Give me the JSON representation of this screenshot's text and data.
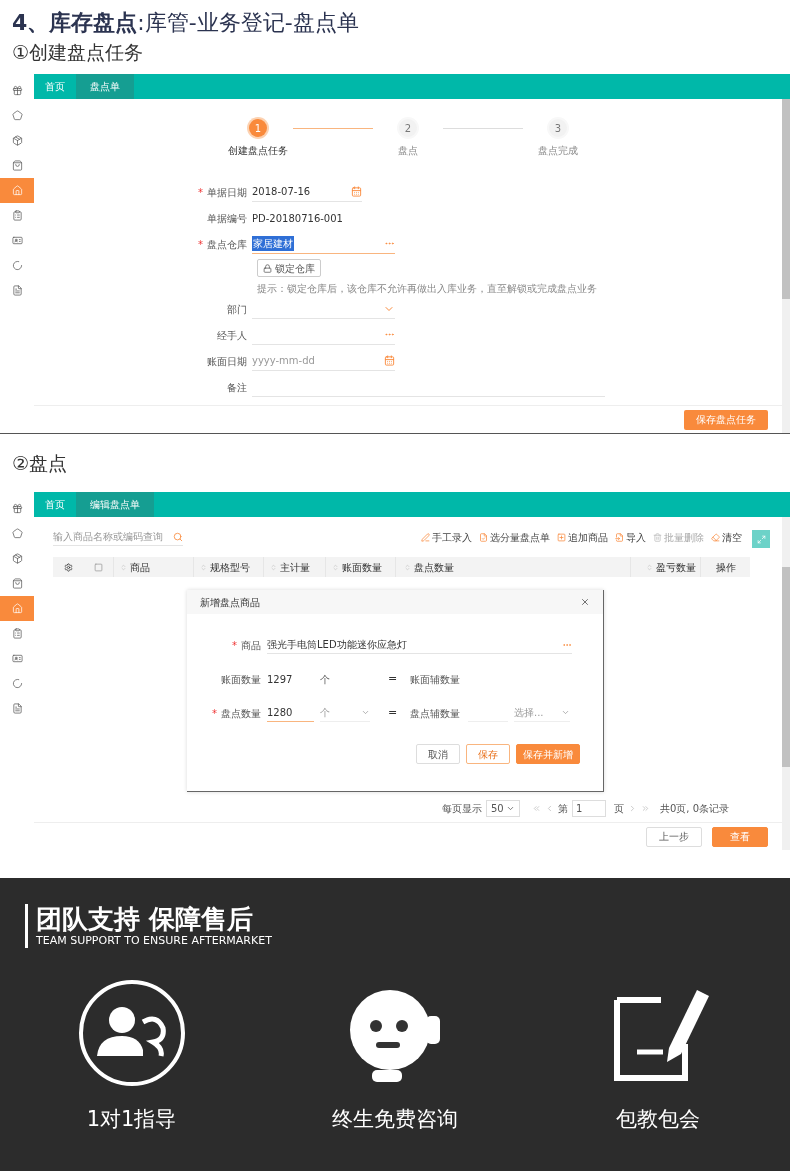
{
  "header": {
    "title": "**4、库存盘点**:库管-业务登记-盘点单",
    "step_heading": "①创建盘点任务"
  },
  "screen_one": {
    "sidebar": [
      {
        "kind": "gift",
        "selected": false
      },
      {
        "kind": "badge",
        "selected": false
      },
      {
        "kind": "bag",
        "selected": false
      },
      {
        "kind": "shop",
        "selected": false
      },
      {
        "kind": "home",
        "selected": true
      },
      {
        "kind": "clipboard",
        "selected": false
      },
      {
        "kind": "card",
        "selected": false
      },
      {
        "kind": "cycle",
        "selected": false
      },
      {
        "kind": "note",
        "selected": false
      }
    ],
    "tabs": [
      {
        "label": "首页",
        "selected": false
      },
      {
        "label": "盘点单",
        "selected": true
      }
    ],
    "steps": [
      {
        "number": "1",
        "label": "创建盘点任务",
        "active": true
      },
      {
        "number": "2",
        "label": "盘点",
        "active": false
      },
      {
        "number": "3",
        "label": "盘点完成",
        "active": false
      }
    ],
    "form_top": [
      {
        "label": "单据日期",
        "required_mark": "*",
        "kind": "date",
        "value": "2018-07-16"
      },
      {
        "label": "单据编号",
        "kind": "static",
        "value": "PD-20180716-001"
      },
      {
        "label": "盘点仓库",
        "required_mark": "*",
        "kind": "picker",
        "value": "家居建材",
        "highlighted": true
      }
    ],
    "lock_button": "锁定仓库",
    "hint": "提示：锁定仓库后，该仓库不允许再做出入库业务，直至解锁或完成盘点业务",
    "form_bottom": [
      {
        "label": "部门",
        "kind": "select"
      },
      {
        "label": "经手人",
        "kind": "picker"
      },
      {
        "label": "账面日期",
        "kind": "date",
        "placeholder": "yyyy-mm-dd"
      },
      {
        "label": "备注",
        "kind": "wide"
      }
    ],
    "save_button": "保存盘点任务"
  },
  "step_two_heading": "②盘点",
  "screen_two": {
    "sidebar": [
      {
        "kind": "gift",
        "selected": false
      },
      {
        "kind": "badge",
        "selected": false
      },
      {
        "kind": "bag",
        "selected": false
      },
      {
        "kind": "shop",
        "selected": false
      },
      {
        "kind": "home",
        "selected": true
      },
      {
        "kind": "clipboard",
        "selected": false
      },
      {
        "kind": "card",
        "selected": false
      },
      {
        "kind": "cycle",
        "selected": false
      },
      {
        "kind": "note",
        "selected": false
      }
    ],
    "tabs": [
      {
        "label": "首页",
        "selected": false
      },
      {
        "label": "编辑盘点单",
        "selected": true
      }
    ],
    "search": {
      "placeholder": "输入商品名称或编码查询"
    },
    "actions": [
      {
        "label": "手工录入",
        "disabled": false
      },
      {
        "label": "选分量盘点单",
        "disabled": false
      },
      {
        "label": "追加商品",
        "disabled": false
      },
      {
        "label": "导入",
        "disabled": false
      },
      {
        "label": "批量删除",
        "disabled": true
      },
      {
        "label": "清空",
        "disabled": false
      }
    ],
    "select_all_checked": false,
    "columns": [
      {
        "label": "商品",
        "sortable": true
      },
      {
        "label": "规格型号",
        "sortable": true
      },
      {
        "label": "主计量",
        "sortable": true
      },
      {
        "label": "账面数量",
        "sortable": true
      },
      {
        "label": "盘点数量",
        "sortable": true
      },
      {
        "label": "盈亏数量",
        "sortable": true
      },
      {
        "label": "操作",
        "sortable": false
      }
    ],
    "modal": {
      "title": "新增盘点商品",
      "product": {
        "label": "商品",
        "required_mark": "*",
        "value": "强光手电筒LED功能迷你应急灯"
      },
      "book": {
        "label": "账面数量",
        "value": "1297",
        "unit": "个",
        "equals": "=",
        "aux_label": "账面辅数量"
      },
      "count": {
        "label": "盘点数量",
        "required_mark": "*",
        "value": "1280",
        "unit": "个",
        "equals": "=",
        "aux_label": "盘点辅数量",
        "aux_placeholder": "选择..."
      },
      "buttons": [
        {
          "label": "取消",
          "kind": "default"
        },
        {
          "label": "保存",
          "kind": "outline"
        },
        {
          "label": "保存并新增",
          "kind": "primary"
        }
      ]
    },
    "pagination": {
      "per_page_label": "每页显示",
      "per_page": "50",
      "page_prefix": "第",
      "page": "1",
      "page_suffix": "页",
      "summary": "共0页, 0条记录"
    },
    "footer_buttons": [
      {
        "label": "上一步",
        "kind": "default"
      },
      {
        "label": "查看",
        "kind": "primary"
      }
    ]
  },
  "support": {
    "title": "团队支持 保障售后",
    "subtitle": "TEAM SUPPORT TO ENSURE AFTERMARKET",
    "features": [
      {
        "kind": "team",
        "label": "1对1指导"
      },
      {
        "kind": "headset",
        "label": "终生免费咨询"
      },
      {
        "kind": "document",
        "label": "包教包会"
      }
    ]
  }
}
